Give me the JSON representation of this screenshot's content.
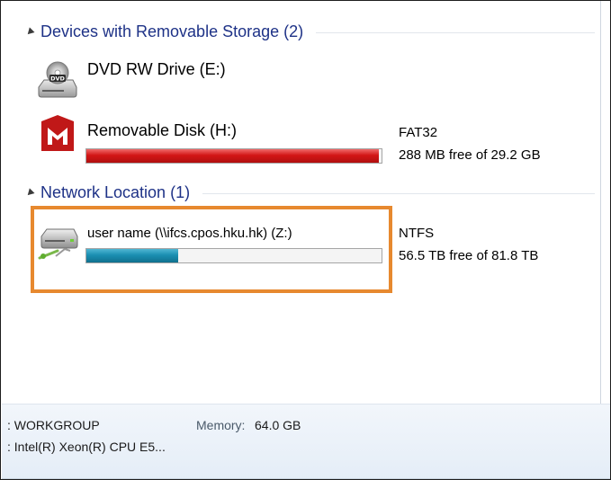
{
  "groups": {
    "removable": {
      "title": "Devices with Removable Storage (2)",
      "drives": [
        {
          "name": "DVD RW Drive (E:)",
          "icon": "dvd-drive-icon",
          "icon_text": "DVD"
        },
        {
          "name": "Removable Disk (H:)",
          "icon": "mcafee-shield-icon",
          "filesystem": "FAT32",
          "free_text": "288 MB free of 29.2 GB",
          "used_fraction": 0.99
        }
      ]
    },
    "network": {
      "title": "Network Location (1)",
      "drives": [
        {
          "name": "user name (\\\\ifcs.cpos.hku.hk) (Z:)",
          "icon": "network-drive-icon",
          "filesystem": "NTFS",
          "free_text": "56.5 TB free of 81.8 TB",
          "used_fraction": 0.31
        }
      ]
    }
  },
  "footer": {
    "workgroup": ": WORKGROUP",
    "memory_label": "Memory:",
    "memory_value": "64.0 GB",
    "processor": ": Intel(R) Xeon(R) CPU E5..."
  },
  "colors": {
    "group_title": "#1e3287",
    "highlight": "#e7892f",
    "bar_red": "#d31616",
    "bar_blue": "#1b8fb2"
  }
}
